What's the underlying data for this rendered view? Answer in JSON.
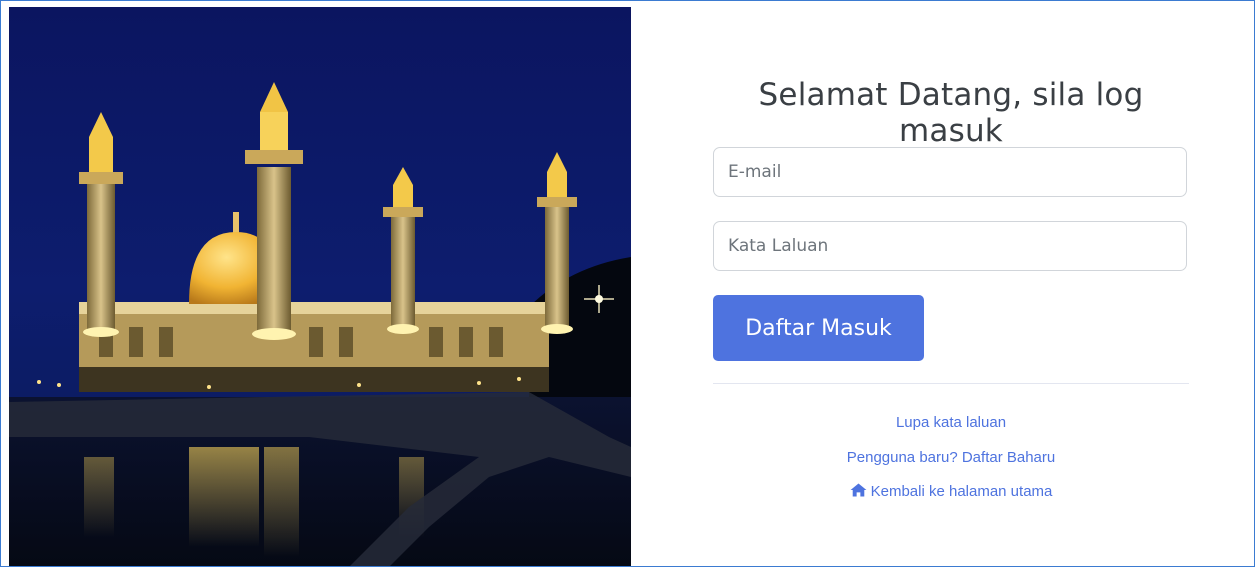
{
  "login": {
    "heading": "Selamat Datang, sila log masuk",
    "email_placeholder": "E-mail",
    "password_placeholder": "Kata Laluan",
    "submit_label": "Daftar Masuk"
  },
  "links": {
    "forgot": "Lupa kata laluan",
    "register": "Pengguna baru? Daftar Baharu",
    "home": "Kembali ke halaman utama"
  },
  "icons": {
    "home": "home-icon"
  },
  "colors": {
    "accent": "#4e73df",
    "frame_border": "#3b7bd1",
    "heading_text": "#3a3f44"
  }
}
